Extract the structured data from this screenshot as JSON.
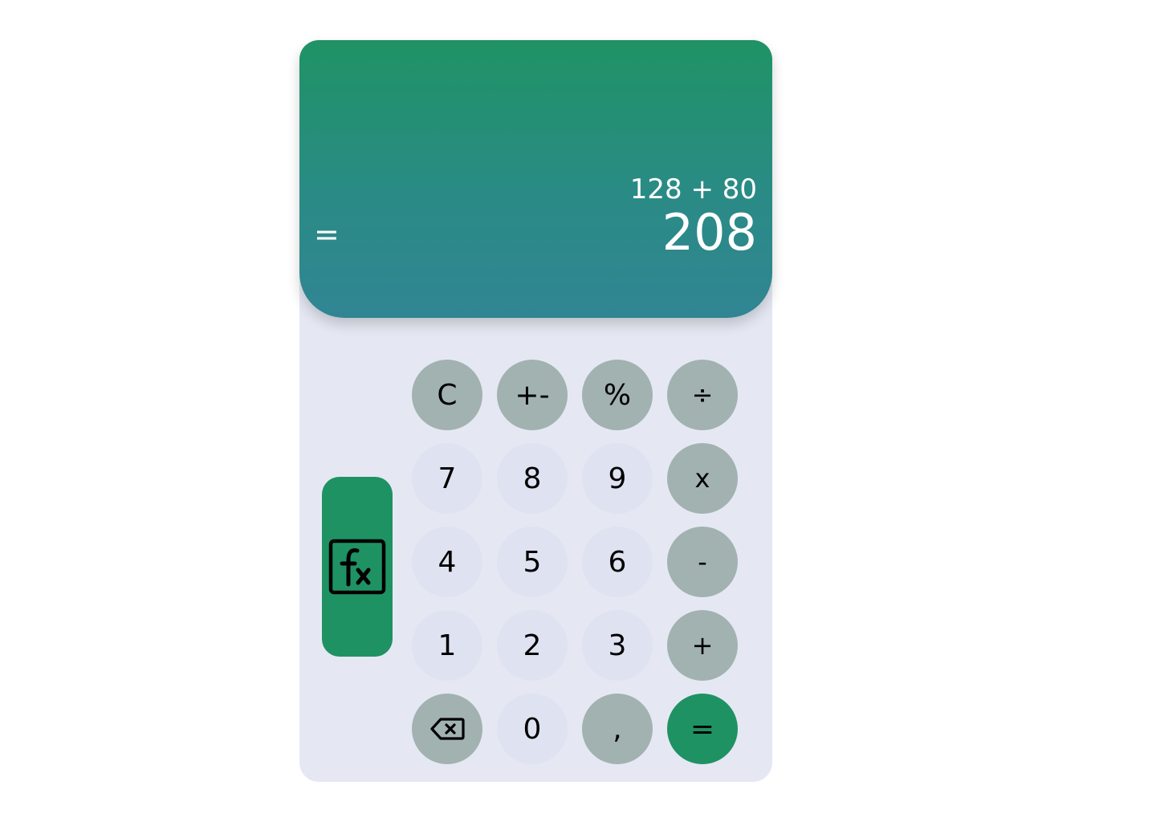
{
  "display": {
    "equals_sign": "=",
    "expression": "128 + 80",
    "result": "208"
  },
  "side": {
    "fx_icon": "function-fx-icon"
  },
  "keys": {
    "clear": "C",
    "sign": "+-",
    "percent": "%",
    "divide": "÷",
    "seven": "7",
    "eight": "8",
    "nine": "9",
    "multiply": "x",
    "four": "4",
    "five": "5",
    "six": "6",
    "subtract": "-",
    "one": "1",
    "two": "2",
    "three": "3",
    "add": "+",
    "backspace_icon": "backspace-icon",
    "zero": "0",
    "decimal": ",",
    "equals": "="
  },
  "colors": {
    "display_top": "#1f9365",
    "display_bottom": "#318593",
    "body": "#e5e8f3",
    "number_key": "#dfe2f1",
    "operator_key": "#a1b2b1",
    "accent": "#1f9264"
  }
}
